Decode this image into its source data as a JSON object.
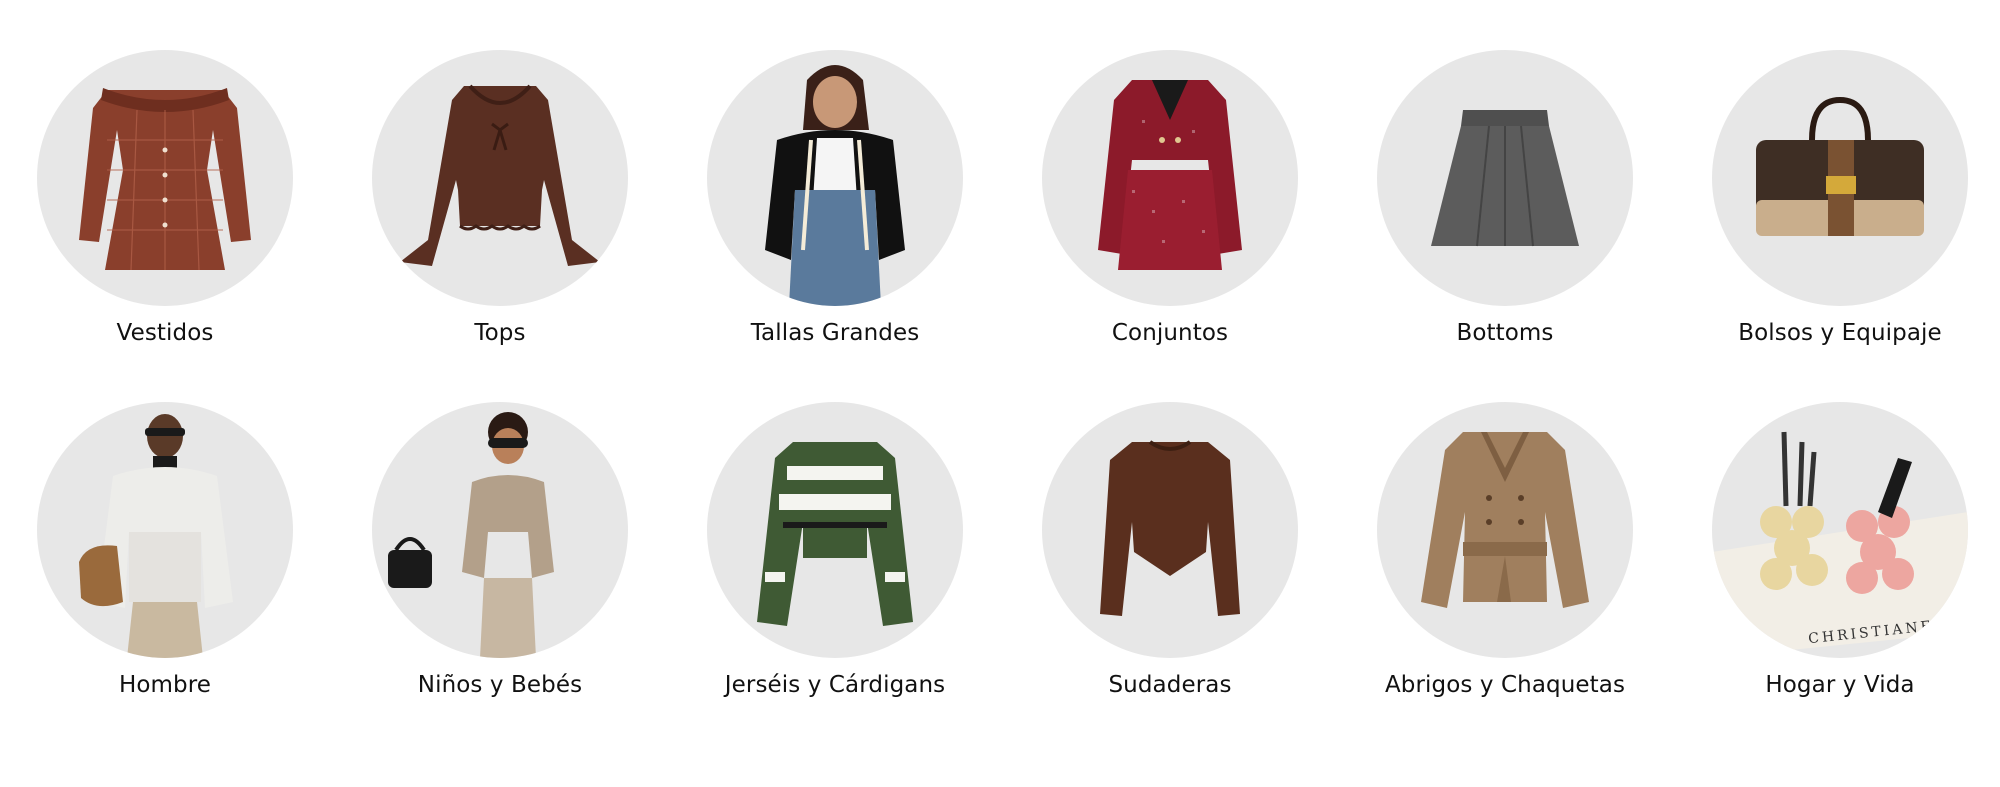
{
  "categories": [
    {
      "label": "Vestidos",
      "icon": "dress-icon"
    },
    {
      "label": "Tops",
      "icon": "top-icon"
    },
    {
      "label": "Tallas Grandes",
      "icon": "plus-size-model-icon"
    },
    {
      "label": "Conjuntos",
      "icon": "set-icon"
    },
    {
      "label": "Bottoms",
      "icon": "skirt-icon"
    },
    {
      "label": "Bolsos y Equipaje",
      "icon": "handbag-icon"
    },
    {
      "label": "Hombre",
      "icon": "man-hoodie-icon"
    },
    {
      "label": "Niños y Bebés",
      "icon": "kid-icon"
    },
    {
      "label": "Jerséis y Cárdigans",
      "icon": "sweater-icon"
    },
    {
      "label": "Sudaderas",
      "icon": "sweatshirt-icon"
    },
    {
      "label": "Abrigos y Chaquetas",
      "icon": "coat-icon"
    },
    {
      "label": "Hogar y Vida",
      "icon": "home-decor-icon"
    }
  ],
  "book_text": "CHRISTIANE",
  "colors": {
    "circle_bg": "#e7e7e7",
    "label_text": "#111111",
    "page_bg": "#ffffff"
  }
}
